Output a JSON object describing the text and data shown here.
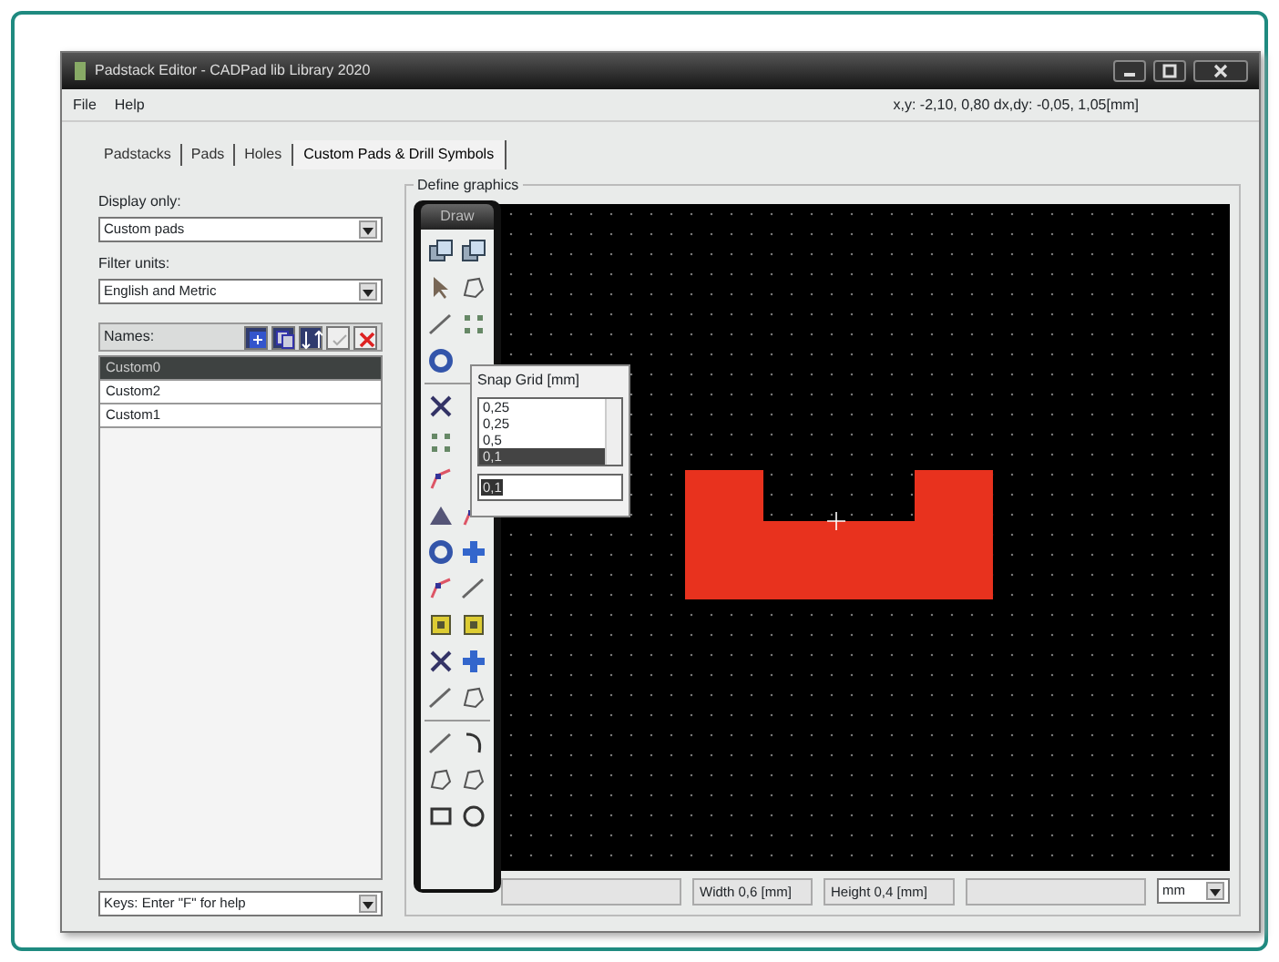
{
  "window": {
    "title": "Padstack Editor - CADPad lib Library 2020"
  },
  "menu": [
    "File",
    "Help"
  ],
  "coordinates": "x,y: -2,10, 0,80  dx,dy: -0,05, 1,05[mm]",
  "tabs": [
    {
      "label": "Padstacks",
      "selected": false
    },
    {
      "label": "Pads",
      "selected": false
    },
    {
      "label": "Holes",
      "selected": false
    },
    {
      "label": "Custom Pads & Drill Symbols",
      "selected": true
    }
  ],
  "display_only": {
    "label": "Display only:",
    "value": "Custom pads"
  },
  "filter_units": {
    "label": "Filter units:",
    "value": "English and Metric"
  },
  "names": {
    "label": "Names:",
    "items": [
      {
        "text": "Custom0",
        "selected": true
      },
      {
        "text": "Custom2",
        "selected": false
      },
      {
        "text": "Custom1",
        "selected": false
      }
    ]
  },
  "keys_dropdown": "Keys: Enter \"F\" for help",
  "define_graphics": {
    "label": "Define graphics",
    "toolbar_title": "Draw"
  },
  "snap_grid": {
    "title": "Snap Grid [mm]",
    "options": [
      {
        "text": "0,25",
        "selected": false
      },
      {
        "text": "0,25",
        "selected": false
      },
      {
        "text": "0,5",
        "selected": false
      },
      {
        "text": "0,1",
        "selected": true
      }
    ],
    "value": "0,1"
  },
  "status": {
    "width": "Width 0,6 [mm]",
    "height": "Height 0,4 [mm]",
    "unit": "mm"
  }
}
